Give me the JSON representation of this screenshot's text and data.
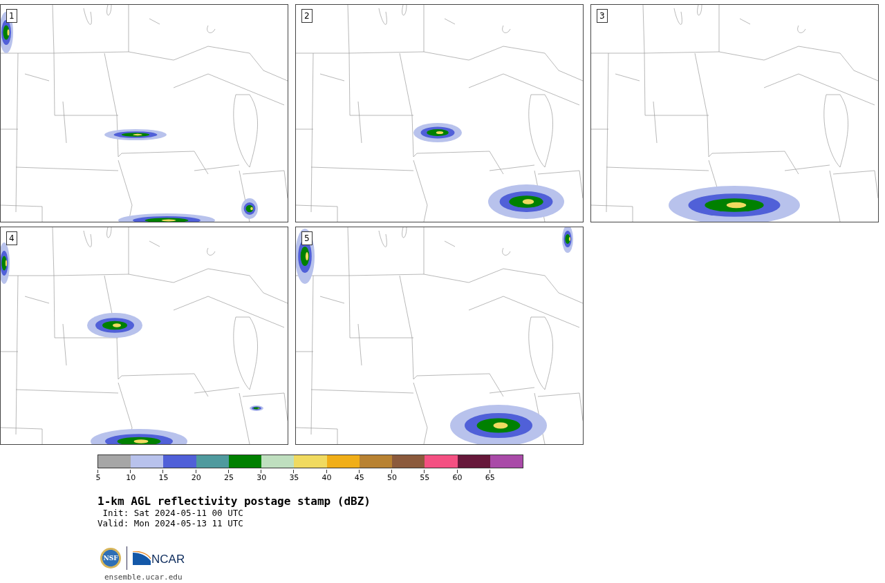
{
  "panels": [
    {
      "label": "1"
    },
    {
      "label": "2"
    },
    {
      "label": "3"
    },
    {
      "label": "4"
    },
    {
      "label": "5"
    }
  ],
  "colorbar": {
    "bins": [
      {
        "color": "#a6a6a6",
        "tick": "5"
      },
      {
        "color": "#b8c2ec",
        "tick": "10"
      },
      {
        "color": "#5060d8",
        "tick": "15"
      },
      {
        "color": "#4f9a9e",
        "tick": "20"
      },
      {
        "color": "#008000",
        "tick": "25"
      },
      {
        "color": "#bfdfbf",
        "tick": "30"
      },
      {
        "color": "#f0da60",
        "tick": "35"
      },
      {
        "color": "#f0ae18",
        "tick": "40"
      },
      {
        "color": "#b88232",
        "tick": "45"
      },
      {
        "color": "#8b5a3c",
        "tick": "50"
      },
      {
        "color": "#f45082",
        "tick": "55"
      },
      {
        "color": "#66183a",
        "tick": "60"
      },
      {
        "color": "#a94aa8",
        "tick": "65"
      }
    ]
  },
  "title": "1-km AGL reflectivity postage stamp (dBZ)",
  "init": " Init: Sat 2024-05-11 00 UTC",
  "valid": "Valid: Mon 2024-05-13 11 UTC",
  "logos": {
    "nsf": "NSF",
    "ncar": "NCAR"
  },
  "footer": "ensemble.ucar.edu"
}
